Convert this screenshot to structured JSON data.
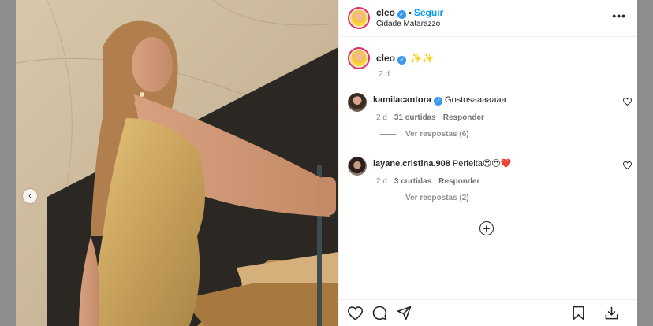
{
  "post": {
    "username": "cleo",
    "follow_label": "Seguir",
    "separator": "•",
    "location": "Cidade Matarazzo",
    "more_label": "•••",
    "caption": {
      "username": "cleo",
      "text": "✨✨",
      "time": "2 d"
    },
    "comments": [
      {
        "username": "kamilacantora",
        "verified": true,
        "text": "Gostosaaaaaaa",
        "time": "2 d",
        "likes": "31 curtidas",
        "reply_label": "Responder",
        "replies_label": "Ver respostas (6)"
      },
      {
        "username": "layane.cristina.908",
        "verified": false,
        "text": "Perfeita😍😍❤️",
        "time": "2 d",
        "likes": "3 curtidas",
        "reply_label": "Responder",
        "replies_label": "Ver respostas (2)"
      }
    ],
    "load_more_label": "+"
  },
  "media": {
    "prev_label": "‹"
  },
  "icons": {
    "verified": "verified-badge-icon",
    "like": "heart-icon",
    "comment": "comment-icon",
    "share": "send-icon",
    "save": "bookmark-icon",
    "download": "download-icon"
  },
  "colors": {
    "accent": "#0095f6",
    "verified": "#3897f0",
    "muted": "#8e8e8e"
  }
}
